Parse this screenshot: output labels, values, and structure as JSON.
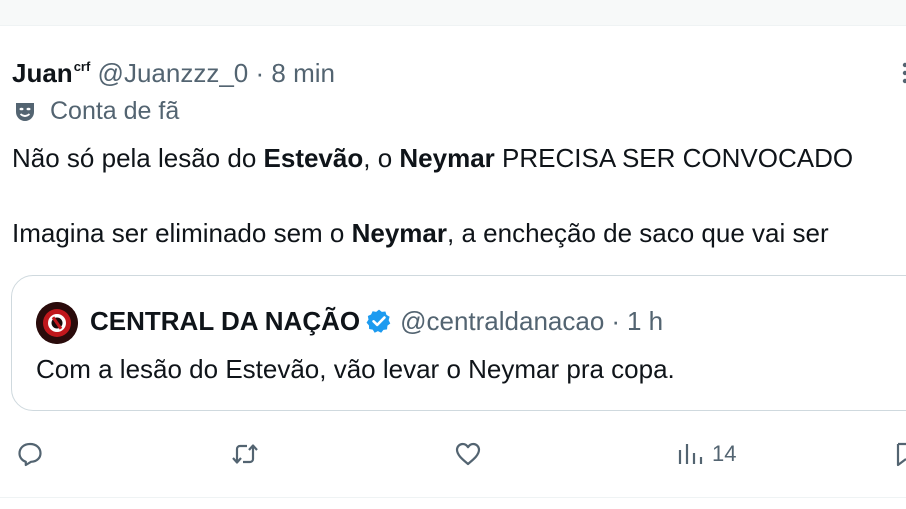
{
  "tweet": {
    "author_name": "Juan",
    "author_suffix": "crf",
    "handle": "@Juanzzz_0",
    "separator": "·",
    "time": "8 min",
    "fan_label": "Conta de fã",
    "line1": {
      "p1": "Não só pela lesão do ",
      "b1": "Estevão",
      "p2": ", o ",
      "b2": "Neymar",
      "p3": " PRECISA SER CONVOCADO"
    },
    "line2": {
      "p1": "Imagina ser eliminado sem o ",
      "b1": "Neymar",
      "p2": ", a encheção de saco que vai ser"
    }
  },
  "quote": {
    "name": "CENTRAL DA NAÇÃO",
    "handle": "@centraldanacao",
    "separator": "·",
    "time": "1 h",
    "text": "Com a lesão do Estevão, vão levar o Neymar pra copa."
  },
  "actions": {
    "reply_icon": "reply-icon",
    "retweet_icon": "retweet-icon",
    "like_icon": "heart-icon",
    "views_icon": "views-icon",
    "views_count": "14",
    "bookmark_icon": "bookmark-icon"
  },
  "colors": {
    "text": "#0f1419",
    "secondary": "#536471",
    "verified": "#1d9bf0",
    "border": "#cfd9de"
  }
}
